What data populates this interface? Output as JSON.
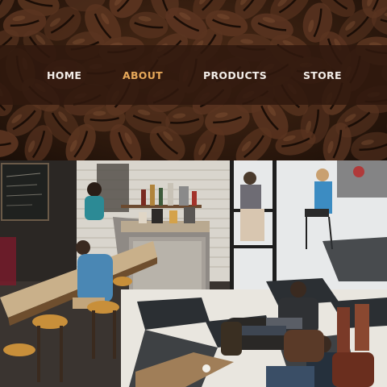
{
  "nav": {
    "items": [
      {
        "label": "HOME",
        "active": false
      },
      {
        "label": "ABOUT",
        "active": true
      },
      {
        "label": "PRODUCTS",
        "active": false
      },
      {
        "label": "STORE",
        "active": false
      }
    ]
  },
  "colors": {
    "navbar_bg": "#30180e",
    "nav_text": "#f3eee9",
    "nav_active": "#e8a95a",
    "bean": "#5a3420"
  },
  "images": {
    "header_background": "coffee-beans-photo",
    "content_photo": "cafe-interior-photo"
  }
}
